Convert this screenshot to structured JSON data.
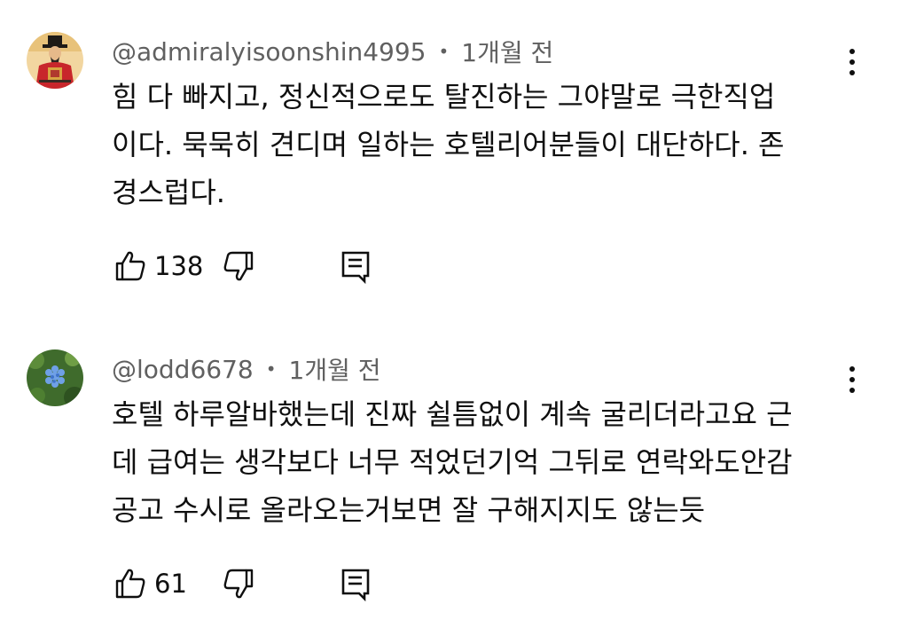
{
  "comments": [
    {
      "author": "@admiralyisoonshin4995",
      "time": "1개월 전",
      "text": "힘 다 빠지고, 정신적으로도 탈진하는 그야말로 극한직업\n이다. 묵묵히 견디며 일하는 호텔리어분들이 대단하다. 존\n경스럽다.",
      "likes": "138",
      "avatar_icon": "portrait-avatar"
    },
    {
      "author": "@lodd6678",
      "time": "1개월 전",
      "text": "호텔 하루알바했는데 진짜 쉴틈없이 계속 굴리더라고요 근\n데 급여는 생각보다 너무 적었던기억 그뒤로 연락와도안감\n공고 수시로 올라오는거보면 잘 구해지지도 않는듯",
      "likes": "61",
      "avatar_icon": "hydrangea-avatar"
    }
  ],
  "separator": "•",
  "icons": {
    "like": "thumbs-up-icon",
    "dislike": "thumbs-down-icon",
    "reply": "reply-comment-icon",
    "menu": "more-vertical-icon"
  }
}
